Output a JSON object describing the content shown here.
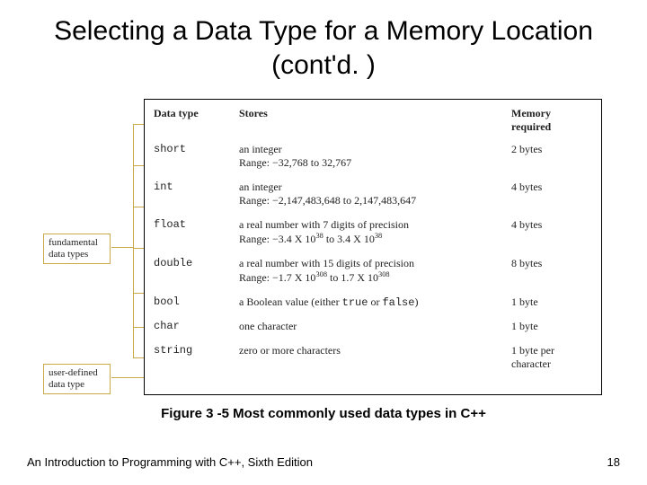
{
  "title": "Selecting a Data Type for a Memory Location (cont'd. )",
  "headers": {
    "type": "Data type",
    "stores": "Stores",
    "mem": "Memory required"
  },
  "rows": [
    {
      "type": "short",
      "stores": "an integer",
      "range": "Range: −32,768 to 32,767",
      "mem": "2 bytes"
    },
    {
      "type": "int",
      "stores": "an integer",
      "range": "Range: −2,147,483,648 to 2,147,483,647",
      "mem": "4 bytes"
    },
    {
      "type": "float",
      "stores": "a real number with 7 digits of precision",
      "range": "Range: −3.4 X 10^38 to 3.4 X 10^38",
      "mem": "4 bytes"
    },
    {
      "type": "double",
      "stores": "a real number with 15 digits of precision",
      "range": "Range: −1.7 X 10^308 to 1.7 X 10^308",
      "mem": "8 bytes"
    },
    {
      "type": "bool",
      "stores": "a Boolean value (either true or false)",
      "range": "",
      "mem": "1 byte"
    },
    {
      "type": "char",
      "stores": "one character",
      "range": "",
      "mem": "1 byte"
    },
    {
      "type": "string",
      "stores": "zero or more characters",
      "range": "",
      "mem": "1 byte per character"
    }
  ],
  "categories": {
    "fundamental": "fundamental data types",
    "userdefined": "user-defined data type"
  },
  "caption": "Figure 3 -5 Most commonly used data types in C++",
  "footer_left": "An Introduction to Programming with C++, Sixth Edition",
  "footer_right": "18"
}
